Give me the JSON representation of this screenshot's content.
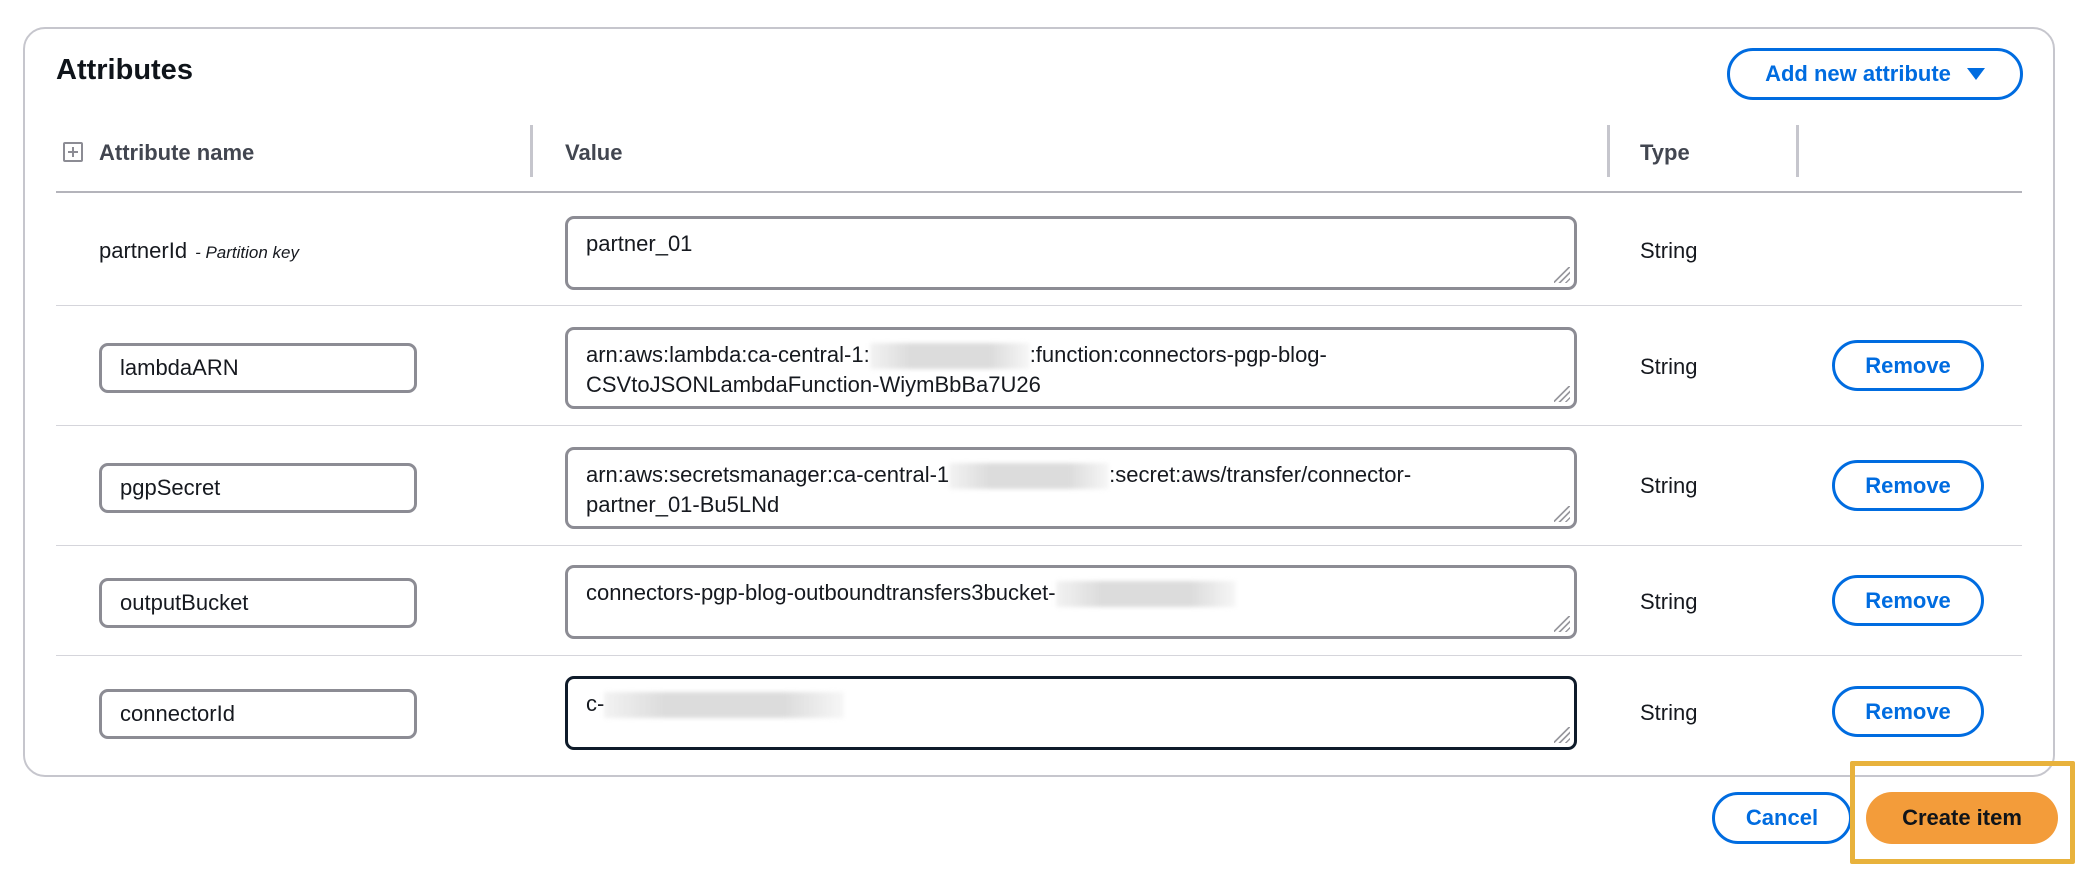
{
  "section": {
    "title": "Attributes",
    "add_button": "Add new attribute"
  },
  "table": {
    "headers": {
      "name": "Attribute name",
      "value": "Value",
      "type": "Type"
    },
    "partition_key": {
      "name": "partnerId",
      "suffix": "- Partition key",
      "value": "partner_01",
      "type": "String"
    },
    "rows": [
      {
        "name": "lambdaARN",
        "value_line1_pre": "arn:aws:lambda:ca-central-1:",
        "value_line1_post": ":function:connectors-pgp-blog-",
        "value_line2": "CSVtoJSONLambdaFunction-WiymBbBa7U26",
        "type": "String",
        "remove": "Remove"
      },
      {
        "name": "pgpSecret",
        "value_line1_pre": "arn:aws:secretsmanager:ca-central-1",
        "value_line1_post": ":secret:aws/transfer/connector-",
        "value_line2": "partner_01-Bu5LNd",
        "type": "String",
        "remove": "Remove"
      },
      {
        "name": "outputBucket",
        "value_line1_pre": "connectors-pgp-blog-outboundtransfers3bucket-",
        "type": "String",
        "remove": "Remove"
      },
      {
        "name": "connectorId",
        "value_line1_pre": "c-",
        "type": "String",
        "remove": "Remove"
      }
    ]
  },
  "footer": {
    "cancel": "Cancel",
    "create": "Create item"
  },
  "colors": {
    "accent": "#006ce0",
    "primary": "#f39c3a",
    "highlight": "#e8b23c"
  },
  "icons": [
    "expand-icon",
    "caret-down-icon",
    "resize-grip-icon"
  ]
}
